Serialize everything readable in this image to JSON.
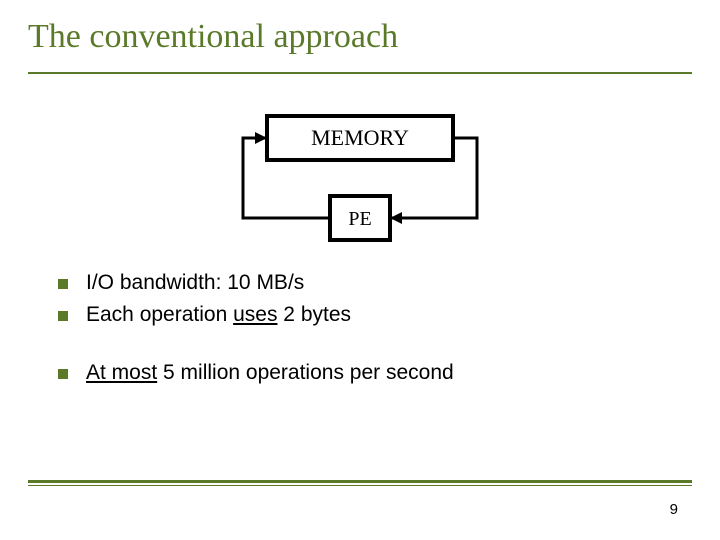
{
  "title": "The conventional approach",
  "diagram": {
    "memory_label": "MEMORY",
    "pe_label": "PE"
  },
  "bullets": {
    "b1": "I/O bandwidth: 10 MB/s",
    "b2_prefix": "Each operation ",
    "b2_u": "uses",
    "b2_suffix": " 2 bytes",
    "b3_u": "At most",
    "b3_suffix": " 5 million operations per second"
  },
  "page_number": "9"
}
